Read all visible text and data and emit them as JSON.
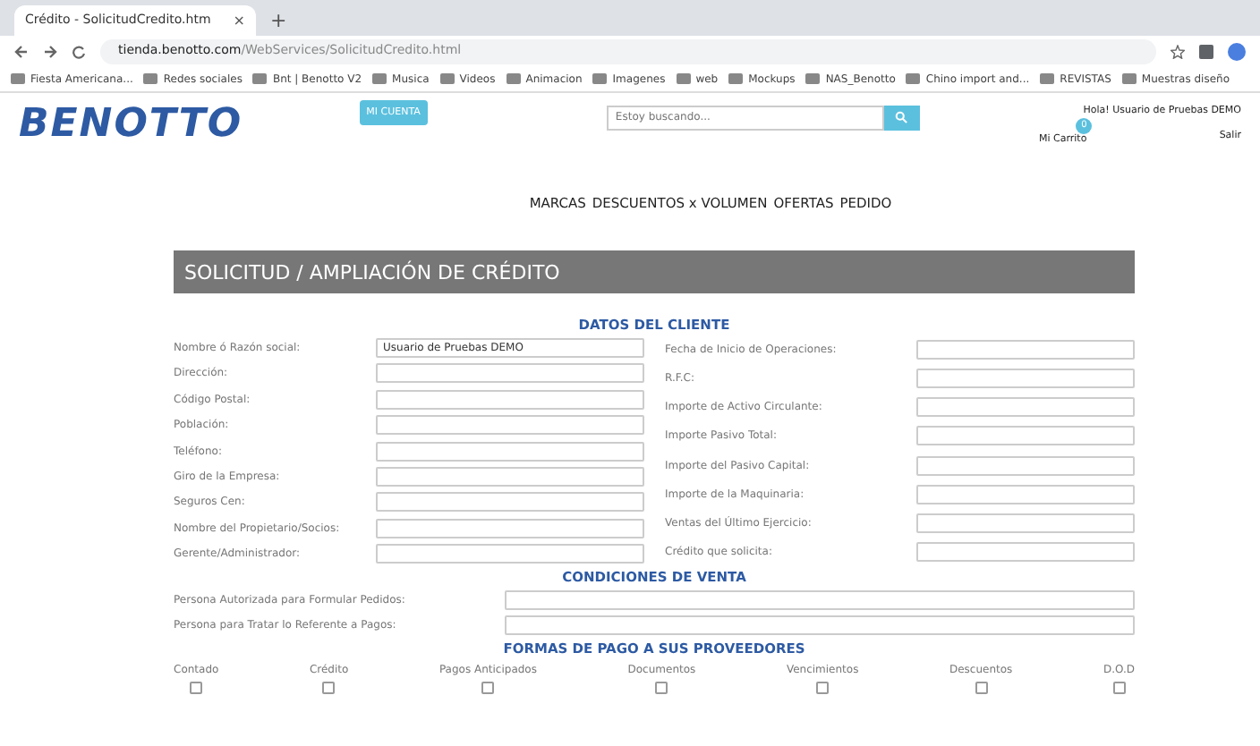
{
  "browser": {
    "tab_title": "Crédito - SolicitudCredito.htm",
    "tab_close": "×",
    "new_tab": "+",
    "url_host": "tienda.benotto.com",
    "url_path": "/WebServices/SolicitudCredito.html",
    "bookmarks": [
      "Fiesta Americana...",
      "Redes sociales",
      "Bnt | Benotto V2",
      "Musica",
      "Videos",
      "Animacion",
      "Imagenes",
      "web",
      "Mockups",
      "NAS_Benotto",
      "Chino import and...",
      "REVISTAS",
      "Muestras diseño"
    ]
  },
  "header": {
    "logo": "BENOTTO",
    "account_button": "MI CUENTA",
    "search_placeholder": "Estoy buscando...",
    "greeting": "Hola! Usuario de Pruebas DEMO",
    "cart": "Mi Carrito",
    "cart_count": "0",
    "logout": "Salir"
  },
  "nav": [
    "MARCAS",
    "DESCUENTOS x VOLUMEN",
    "OFERTAS",
    "PEDIDO"
  ],
  "banner": "SOLICITUD / AMPLIACIÓN DE CRÉDITO",
  "client_section": {
    "title": "DATOS DEL CLIENTE",
    "left": [
      {
        "label": "Nombre ó Razón social:",
        "value": "Usuario de Pruebas DEMO"
      },
      {
        "label": "Dirección:"
      },
      {
        "label": "Código Postal:"
      },
      {
        "label": "Población:"
      },
      {
        "label": "Teléfono:"
      },
      {
        "label": "Giro de la Empresa:"
      },
      {
        "label": "Seguros Cen:"
      },
      {
        "label": "Nombre del Propietario/Socios:"
      },
      {
        "label": "Gerente/Administrador:"
      }
    ],
    "right": [
      {
        "label": "Fecha de Inicio de Operaciones:"
      },
      {
        "label": "R.F.C:"
      },
      {
        "label": "Importe de Activo Circulante:"
      },
      {
        "label": "Importe Pasivo Total:"
      },
      {
        "label": "Importe del Pasivo Capital:"
      },
      {
        "label": "Importe de la Maquinaria:"
      },
      {
        "label": "Ventas del Último Ejercicio:"
      },
      {
        "label": "Crédito que solicita:"
      }
    ]
  },
  "sales_section": {
    "title": "CONDICIONES DE VENTA",
    "fields": [
      {
        "label": "Persona Autorizada para Formular Pedidos:"
      },
      {
        "label": "Persona para Tratar lo Referente a Pagos:"
      }
    ]
  },
  "payment_section": {
    "title": "FORMAS DE PAGO A SUS PROVEEDORES",
    "options": [
      {
        "label": "Contado",
        "checked": false
      },
      {
        "label": "Crédito",
        "checked": false
      },
      {
        "label": "Pagos Anticipados",
        "checked": false
      },
      {
        "label": "Documentos",
        "checked": false
      },
      {
        "label": "Vencimientos",
        "checked": false
      },
      {
        "label": "Descuentos",
        "checked": false
      },
      {
        "label": "D.O.D",
        "checked": false
      }
    ]
  }
}
